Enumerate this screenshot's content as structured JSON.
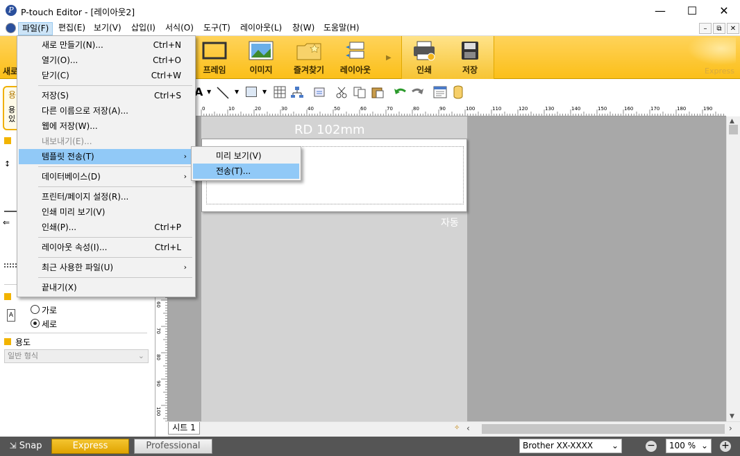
{
  "window": {
    "title": "P-touch Editor - [레이아웃2]",
    "minimize_glyph": "—",
    "maximize_glyph": "☐",
    "close_glyph": "✕"
  },
  "menubar": {
    "items": [
      "파일(F)",
      "편집(E)",
      "보기(V)",
      "삽입(I)",
      "서식(O)",
      "도구(T)",
      "레이아웃(L)",
      "창(W)",
      "도움말(H)"
    ],
    "mdi": [
      "–",
      "⧉",
      "✕"
    ]
  },
  "ribbon": {
    "partial_left": "새로",
    "buttons": [
      "프레임",
      "이미지",
      "즐겨찾기",
      "레이아웃",
      "인쇄",
      "저장"
    ],
    "express_label": "Express",
    "colors": {
      "ribbon_top": "#ffd35a",
      "ribbon_bottom": "#fbbf19"
    }
  },
  "left_panel": {
    "partial_top": [
      "용",
      "용",
      "있"
    ],
    "orientation_options": [
      "가로",
      "세로"
    ],
    "orientation_selected": "세로",
    "purpose_heading": "용도",
    "purpose_value": "일반 형식"
  },
  "canvas": {
    "media_label": "RD 102mm",
    "auto_label": "자동",
    "sheet_tab": "시트 1",
    "ruler_h_ticks": [
      "0",
      "10",
      "20",
      "30",
      "40",
      "50",
      "60",
      "70",
      "80",
      "90",
      "100",
      "110",
      "120",
      "130",
      "140",
      "150",
      "160",
      "170",
      "180",
      "190"
    ],
    "ruler_v_ticks": [
      "60",
      "70",
      "80",
      "90",
      "100"
    ]
  },
  "file_menu": {
    "items": [
      {
        "label": "새로 만들기(N)...",
        "shortcut": "Ctrl+N"
      },
      {
        "label": "열기(O)...",
        "shortcut": "Ctrl+O"
      },
      {
        "label": "닫기(C)",
        "shortcut": "Ctrl+W"
      },
      {
        "label": "저장(S)",
        "shortcut": "Ctrl+S"
      },
      {
        "label": "다른 이름으로 저장(A)...",
        "shortcut": ""
      },
      {
        "label": "웹에 저장(W)...",
        "shortcut": ""
      },
      {
        "label": "내보내기(E)...",
        "shortcut": ""
      },
      {
        "label": "템플릿 전송(T)",
        "shortcut": ""
      },
      {
        "label": "데이터베이스(D)",
        "shortcut": ""
      },
      {
        "label": "프린터/페이지 설정(R)...",
        "shortcut": ""
      },
      {
        "label": "인쇄 미리 보기(V)",
        "shortcut": ""
      },
      {
        "label": "인쇄(P)...",
        "shortcut": "Ctrl+P"
      },
      {
        "label": "레이아웃 속성(I)...",
        "shortcut": "Ctrl+L"
      },
      {
        "label": "최근 사용한 파일(U)",
        "shortcut": ""
      },
      {
        "label": "끝내기(X)",
        "shortcut": ""
      }
    ],
    "submenu_arrow": "›"
  },
  "template_submenu": {
    "items": [
      "미리 보기(V)",
      "전송(T)..."
    ]
  },
  "statusbar": {
    "snap": "Snap",
    "express": "Express",
    "professional": "Professional",
    "printer": "Brother  XX-XXXX",
    "zoom": "100 %",
    "zoom_out": "−",
    "zoom_in": "+"
  }
}
